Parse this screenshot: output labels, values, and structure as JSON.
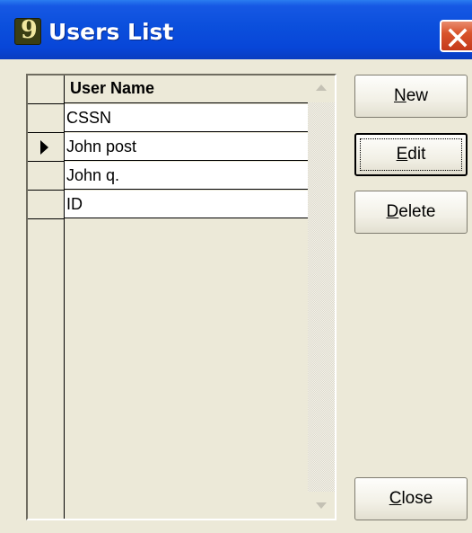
{
  "window": {
    "title": "Users List",
    "app_icon": "app-logo-icon",
    "app_icon_glyph": "9",
    "close_icon": "close-icon"
  },
  "grid": {
    "column_header": "User Name",
    "current_row_index": 1,
    "rows": [
      {
        "user_name": "CSSN"
      },
      {
        "user_name": "John post"
      },
      {
        "user_name": "John q."
      },
      {
        "user_name": "ID"
      }
    ]
  },
  "buttons": {
    "new": {
      "mnemonic": "N",
      "rest": "ew"
    },
    "edit": {
      "mnemonic": "E",
      "rest": "dit"
    },
    "delete": {
      "mnemonic": "D",
      "rest": "elete"
    },
    "close": {
      "mnemonic": "C",
      "rest": "lose"
    }
  },
  "colors": {
    "titlebar": "#0846d8",
    "dialog_bg": "#ece9d8",
    "close_button": "#d9542c"
  }
}
